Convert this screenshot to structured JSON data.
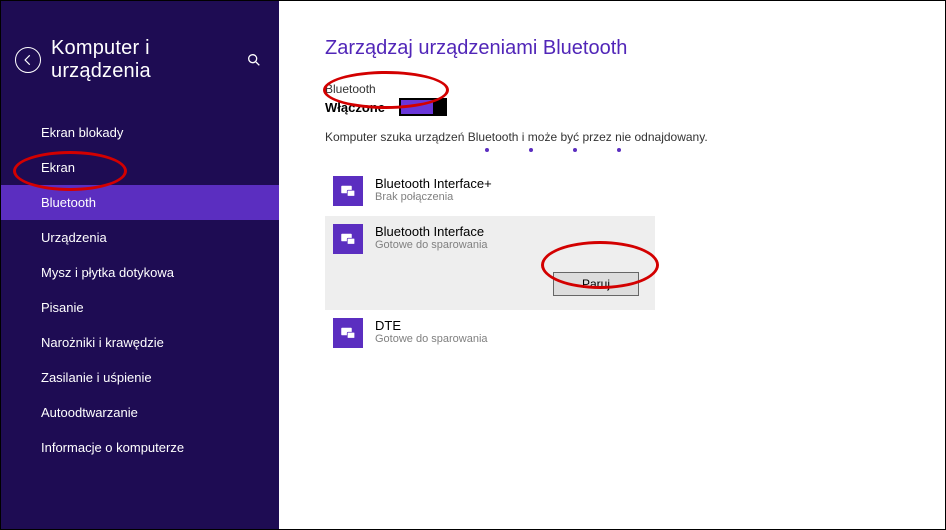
{
  "sidebar": {
    "title": "Komputer i urządzenia",
    "items": [
      {
        "label": "Ekran blokady"
      },
      {
        "label": "Ekran"
      },
      {
        "label": "Bluetooth",
        "active": true
      },
      {
        "label": "Urządzenia"
      },
      {
        "label": "Mysz i płytka dotykowa"
      },
      {
        "label": "Pisanie"
      },
      {
        "label": "Narożniki i krawędzie"
      },
      {
        "label": "Zasilanie i uśpienie"
      },
      {
        "label": "Autoodtwarzanie"
      },
      {
        "label": "Informacje o komputerze"
      }
    ]
  },
  "main": {
    "title": "Zarządzaj urządzeniami Bluetooth",
    "toggle": {
      "label": "Bluetooth",
      "state": "Włączone"
    },
    "status": "Komputer szuka urządzeń Bluetooth i może być przez nie odnajdowany.",
    "devices": [
      {
        "name": "Bluetooth Interface+",
        "status": "Brak połączenia"
      },
      {
        "name": "Bluetooth Interface",
        "status": "Gotowe do sparowania",
        "selected": true,
        "action": "Paruj"
      },
      {
        "name": "DTE",
        "status": "Gotowe do sparowania"
      }
    ]
  }
}
